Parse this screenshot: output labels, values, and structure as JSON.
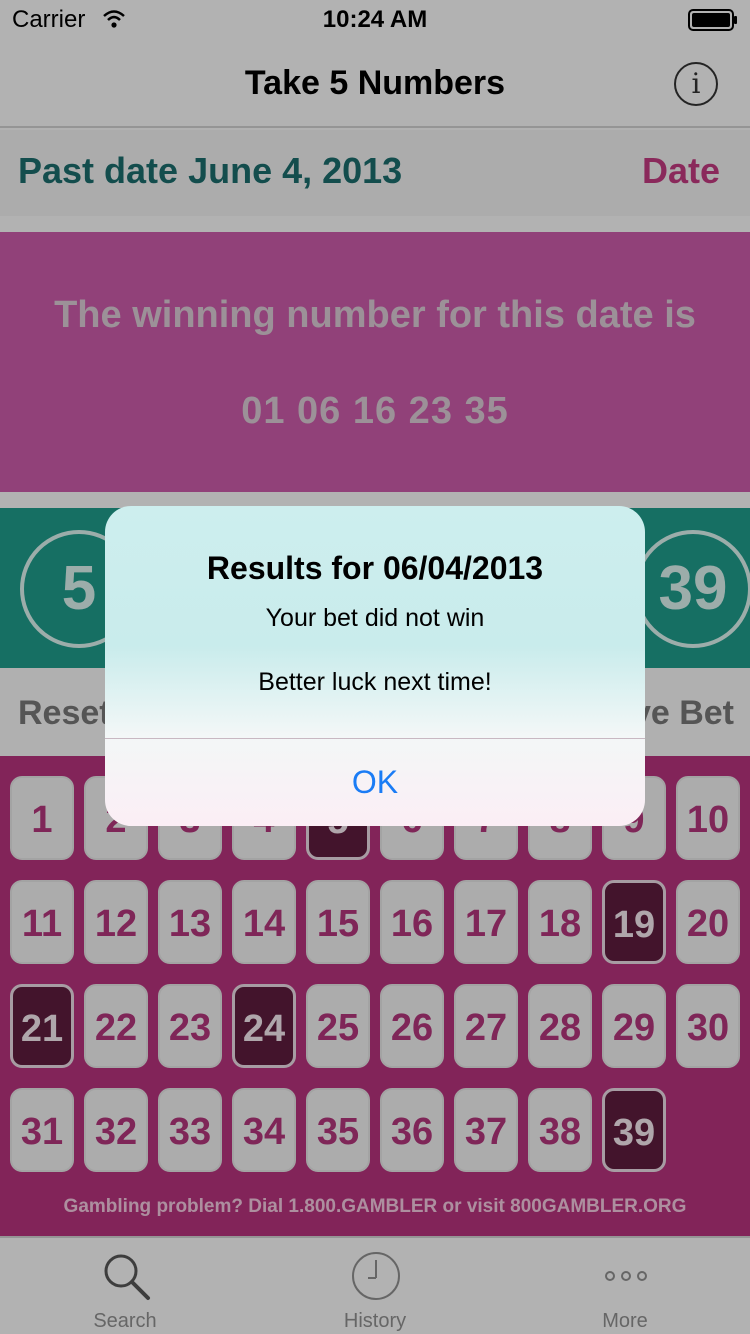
{
  "status_bar": {
    "carrier": "Carrier",
    "time": "10:24 AM"
  },
  "nav": {
    "title": "Take 5 Numbers",
    "info_icon": "info-icon"
  },
  "date_bar": {
    "label": "Past date June 4, 2013",
    "button": "Date"
  },
  "winning": {
    "heading": "The winning number for this date is",
    "numbers": "01 06 16 23 35"
  },
  "picks": [
    "5",
    "39"
  ],
  "actions": {
    "reset": "Reset",
    "save": "ve Bet"
  },
  "grid": {
    "numbers": [
      "1",
      "2",
      "3",
      "4",
      "5",
      "6",
      "7",
      "8",
      "9",
      "10",
      "11",
      "12",
      "13",
      "14",
      "15",
      "16",
      "17",
      "18",
      "19",
      "20",
      "21",
      "22",
      "23",
      "24",
      "25",
      "26",
      "27",
      "28",
      "29",
      "30",
      "31",
      "32",
      "33",
      "34",
      "35",
      "36",
      "37",
      "38",
      "39"
    ],
    "selected": [
      "5",
      "19",
      "21",
      "24",
      "39"
    ]
  },
  "disclaimer": "Gambling problem? Dial 1.800.GAMBLER or visit 800GAMBLER.ORG",
  "tabs": [
    {
      "label": "Search",
      "icon": "search-icon"
    },
    {
      "label": "History",
      "icon": "clock-icon"
    },
    {
      "label": "More",
      "icon": "more-icon"
    }
  ],
  "alert": {
    "title": "Results for 06/04/2013",
    "message1": "Your bet did not win",
    "message2": "Better luck next time!",
    "ok": "OK"
  },
  "colors": {
    "teal": "#1f9a8a",
    "magenta": "#b5337c",
    "pink": "#c95aa8",
    "accent_blue": "#1a7cf5"
  }
}
